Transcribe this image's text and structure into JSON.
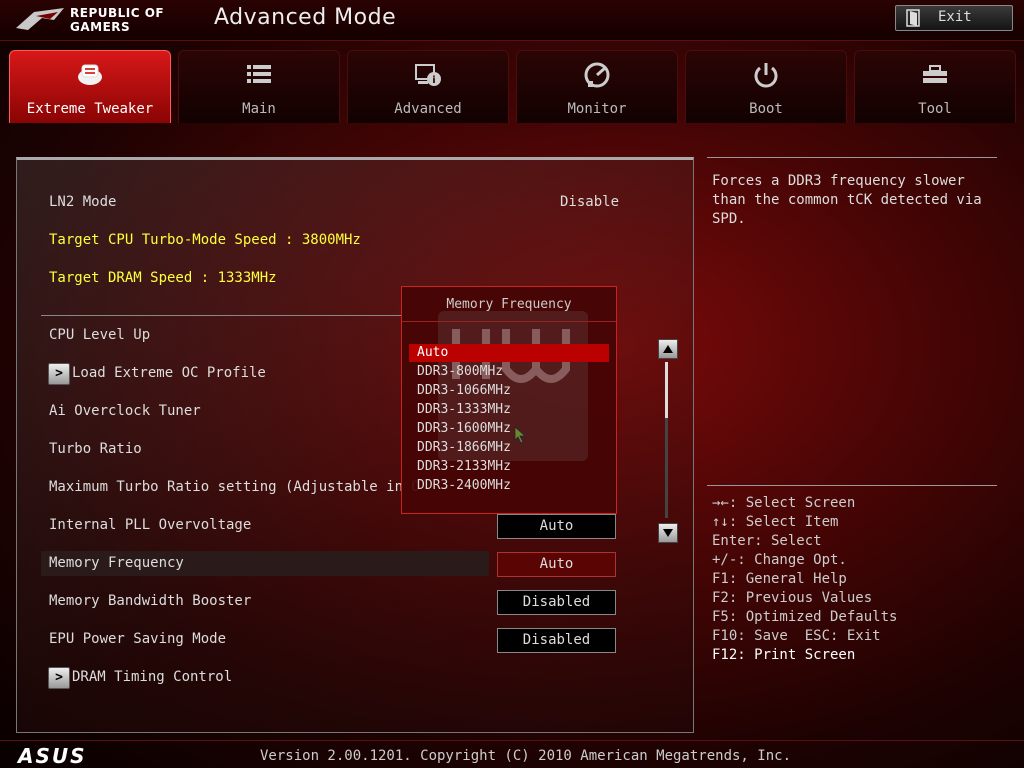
{
  "header": {
    "brand_line1": "REPUBLIC OF",
    "brand_line2": "GAMERS",
    "title": "Advanced Mode",
    "exit_label": "Exit"
  },
  "tabs": [
    {
      "label": "Extreme Tweaker",
      "icon": "cpu-chip-icon",
      "active": true
    },
    {
      "label": "Main",
      "icon": "list-icon",
      "active": false
    },
    {
      "label": "Advanced",
      "icon": "advanced-settings-icon",
      "active": false
    },
    {
      "label": "Monitor",
      "icon": "gauge-icon",
      "active": false
    },
    {
      "label": "Boot",
      "icon": "power-icon",
      "active": false
    },
    {
      "label": "Tool",
      "icon": "toolbox-icon",
      "active": false
    }
  ],
  "main": {
    "ln2_label": "LN2 Mode",
    "ln2_value": "Disable",
    "target_cpu": "Target CPU Turbo-Mode Speed : 3800MHz",
    "target_dram": "Target DRAM Speed : 1333MHz",
    "cpu_level_up": "CPU Level Up",
    "load_profile": "Load Extreme OC Profile",
    "ai_overclock": "Ai Overclock Tuner",
    "turbo_ratio": "Turbo Ratio",
    "max_turbo": "Maximum Turbo Ratio setting (Adjustable in O",
    "pll_overvoltage": "Internal PLL Overvoltage",
    "pll_value": "Auto",
    "memory_frequency": "Memory Frequency",
    "memory_frequency_value": "Auto",
    "bandwidth_booster": "Memory Bandwidth Booster",
    "bandwidth_value": "Disabled",
    "epu_power": "EPU Power Saving Mode",
    "epu_value": "Disabled",
    "dram_timing": "DRAM Timing Control"
  },
  "popup": {
    "title": "Memory Frequency",
    "options": [
      "Auto",
      "DDR3-800MHz",
      "DDR3-1066MHz",
      "DDR3-1333MHz",
      "DDR3-1600MHz",
      "DDR3-1866MHz",
      "DDR3-2133MHz",
      "DDR3-2400MHz"
    ],
    "selected": "Auto"
  },
  "help": {
    "text": "Forces a DDR3 frequency slower than the common tCK detected via SPD.",
    "keys": [
      "→←: Select Screen",
      "↑↓: Select Item",
      "Enter: Select",
      "+/-: Change Opt.",
      "F1: General Help",
      "F2: Previous Values",
      "F5: Optimized Defaults",
      "F10: Save  ESC: Exit",
      "F12: Print Screen"
    ]
  },
  "footer": {
    "brand": "ASUS",
    "version": "Version 2.00.1201. Copyright (C) 2010 American Megatrends, Inc."
  },
  "colors": {
    "accent": "#cc0000",
    "highlight_text": "#ffff3c",
    "background": "#4a0505"
  }
}
